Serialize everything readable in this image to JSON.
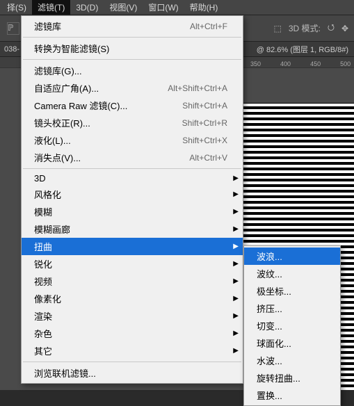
{
  "menubar": {
    "items": [
      "择(S)",
      "滤镜(T)",
      "3D(D)",
      "视图(V)",
      "窗口(W)",
      "帮助(H)"
    ],
    "open_index": 1
  },
  "toolbar": {
    "mode_label": "3D 模式:"
  },
  "tabs": {
    "left": "038-",
    "right": "@ 82.6% (图层 1, RGB/8#)"
  },
  "ruler": {
    "ticks": [
      "350",
      "400",
      "450",
      "500"
    ]
  },
  "main_menu": {
    "section0": {
      "label": "滤镜库",
      "accel": "Alt+Ctrl+F"
    },
    "section1": {
      "label": "转换为智能滤镜(S)"
    },
    "section2": [
      {
        "label": "滤镜库(G)...",
        "accel": ""
      },
      {
        "label": "自适应广角(A)...",
        "accel": "Alt+Shift+Ctrl+A"
      },
      {
        "label": "Camera Raw 滤镜(C)...",
        "accel": "Shift+Ctrl+A"
      },
      {
        "label": "镜头校正(R)...",
        "accel": "Shift+Ctrl+R"
      },
      {
        "label": "液化(L)...",
        "accel": "Shift+Ctrl+X"
      },
      {
        "label": "消失点(V)...",
        "accel": "Alt+Ctrl+V"
      }
    ],
    "section3": [
      "3D",
      "风格化",
      "模糊",
      "模糊画廊",
      "扭曲",
      "锐化",
      "视频",
      "像素化",
      "渲染",
      "杂色",
      "其它"
    ],
    "highlight": "扭曲",
    "section4": {
      "label": "浏览联机滤镜..."
    }
  },
  "submenu": {
    "items": [
      "波浪...",
      "波纹...",
      "极坐标...",
      "挤压...",
      "切变...",
      "球面化...",
      "水波...",
      "旋转扭曲...",
      "置换..."
    ],
    "highlight": "波浪..."
  }
}
